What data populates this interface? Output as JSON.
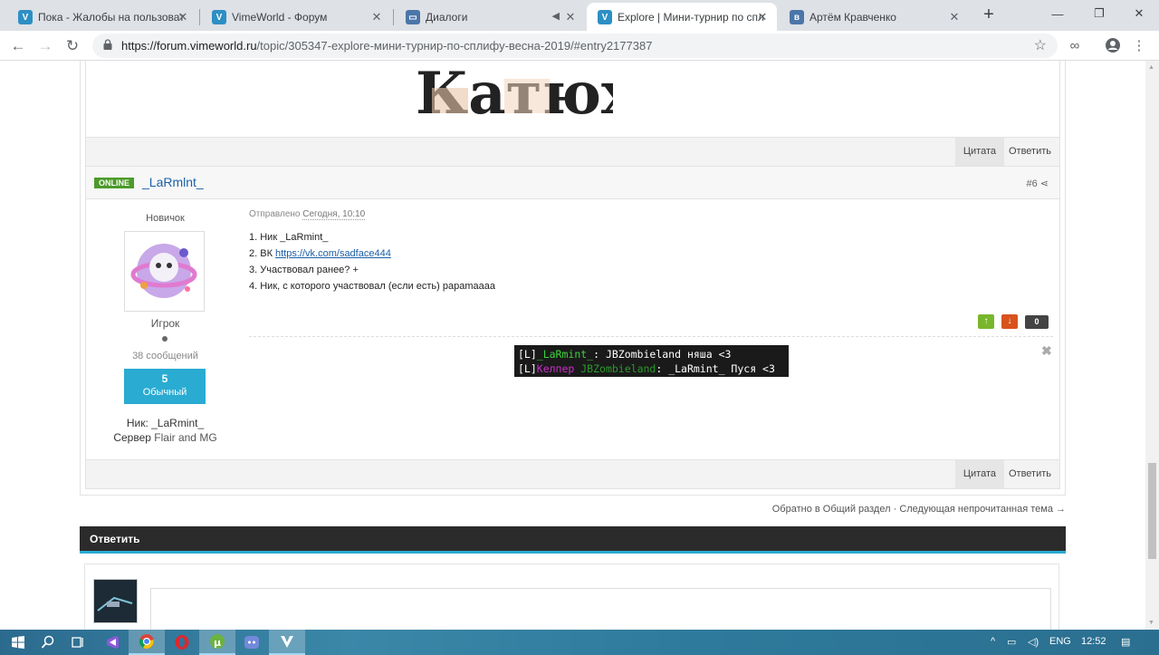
{
  "browser": {
    "tabs": [
      {
        "title": "Пока - Жалобы на пользоват",
        "active": false
      },
      {
        "title": "VimeWorld - Форум",
        "active": false
      },
      {
        "title": "Диалоги",
        "active": false
      },
      {
        "title": "Explore | Мини-турнир по спл",
        "active": true
      },
      {
        "title": "Артём Кравченко",
        "active": false
      }
    ],
    "url_host": "https://forum.vimeworld.ru",
    "url_path": "/topic/305347-explore-мини-турнир-по-сплифу-весна-2019/#entry2177387"
  },
  "signature_logo_text": "Катюха",
  "post_footer_prev": {
    "quote": "Цитата",
    "reply": "Ответить"
  },
  "post": {
    "online_badge": "ONLINE",
    "author": "_LaRmlnt_",
    "number": "#6",
    "rank": "Новичок",
    "group": "Игрок",
    "messages": "38 сообщений",
    "reputation_value": "5",
    "reputation_label": "Обычный",
    "field_nick_label": "Ник:",
    "field_nick_value": "_LaRmint_",
    "field_server_label": "Сервер",
    "field_server_value": "Flair and MG",
    "posted_label": "Отправлено",
    "posted_date": "Сегодня, 10:10",
    "line1": "1. Ник _LaRmint_",
    "line2_label": "2. ВК ",
    "line2_link": "https://vk.com/sadface444",
    "line3": "3. Участвовал ранее? +",
    "line4": "4. Ник, с которого участвовал (если есть) papamaaaa",
    "vote_count": "0",
    "chat_line1_a": "[L]",
    "chat_line1_name": "_LaRmint_",
    "chat_line1_b": ": JBZombieland няша <3",
    "chat_line2_a": "[L]",
    "chat_line2_name": "Келпер",
    "chat_line2_mid": " JBZombieland",
    "chat_line2_b": ": _LaRmint_ Пуся <3",
    "quote_btn": "Цитата",
    "reply_btn": "Ответить"
  },
  "breadcrumb": {
    "back": "Обратно в Общий раздел",
    "sep": " · ",
    "next": "Следующая непрочитанная тема →"
  },
  "reply_section": {
    "title": "Ответить"
  },
  "taskbar": {
    "lang": "ENG",
    "time": "12:52"
  },
  "colors": {
    "accent": "#2aabd2",
    "online": "#4c9a2a",
    "link": "#1a5fa6",
    "vote_up": "#78b62c",
    "vote_down": "#d9531e"
  }
}
